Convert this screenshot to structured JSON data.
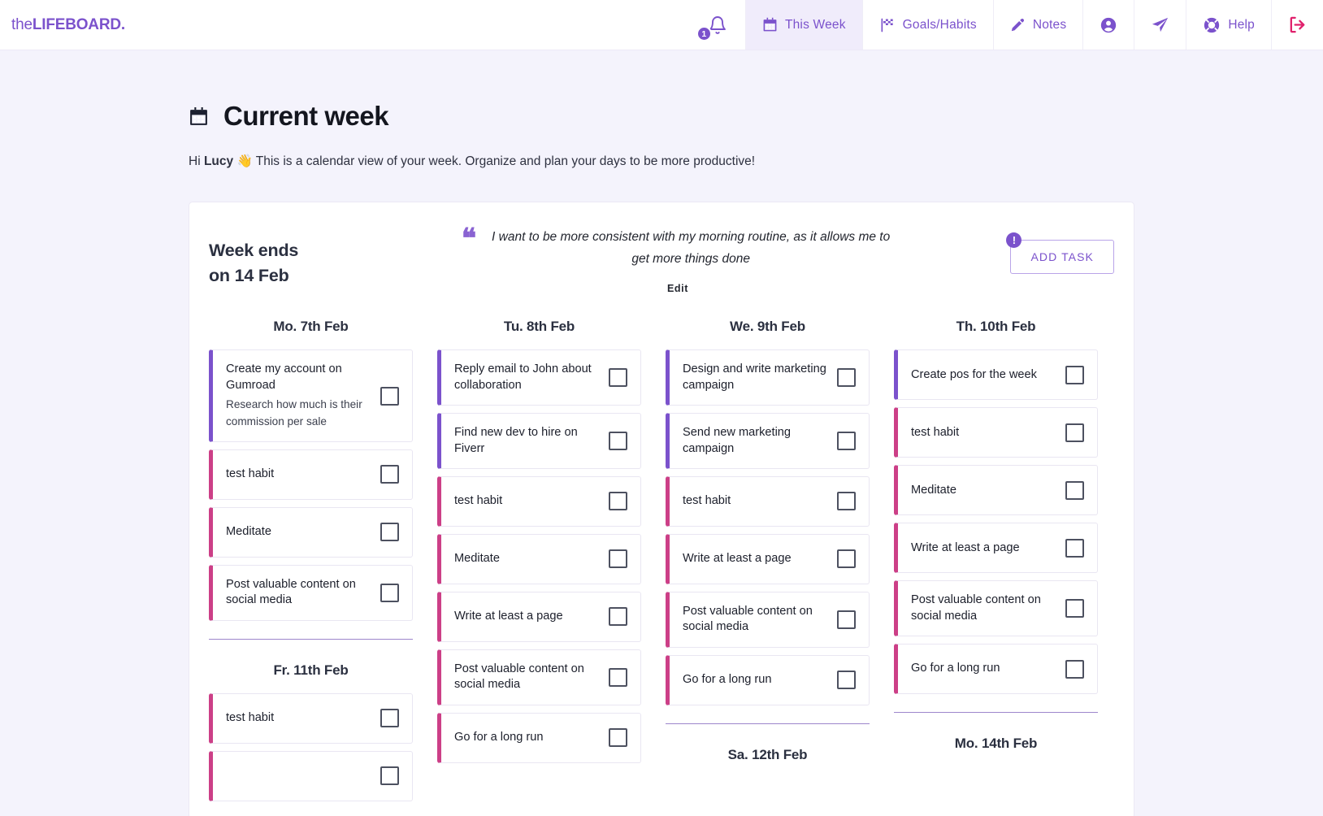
{
  "brand": {
    "thin": "the",
    "thick": "LIFEBOARD."
  },
  "nav": {
    "notifications_count": "1",
    "items": [
      {
        "label": "This Week",
        "icon": "calendar-icon",
        "active": true
      },
      {
        "label": "Goals/Habits",
        "icon": "flag-icon",
        "active": false
      },
      {
        "label": "Notes",
        "icon": "pen-icon",
        "active": false
      },
      {
        "label": "",
        "icon": "account-icon",
        "active": false
      },
      {
        "label": "",
        "icon": "send-icon",
        "active": false
      },
      {
        "label": "Help",
        "icon": "lifering-icon",
        "active": false
      },
      {
        "label": "",
        "icon": "logout-icon",
        "active": false
      }
    ]
  },
  "header": {
    "title": "Current week",
    "greeting_pre": "Hi ",
    "greeting_name": "Lucy",
    "greeting_post": " 👋 This is a calendar view of your week. Organize and plan your days to be more productive!"
  },
  "panel": {
    "week_ends_line1": "Week ends",
    "week_ends_line2": "on 14 Feb",
    "quote": "I want to be more consistent with my morning routine, as it allows me to get more things done",
    "quote_edit": "Edit",
    "add_task": "ADD TASK",
    "info_badge": "!"
  },
  "colors": {
    "accent": "#7b52cc",
    "habit": "#cc3f87",
    "logout": "#e0206c",
    "nav_active_bg": "#f0ecfb",
    "page_bg": "#f4f3fc"
  },
  "columns": [
    {
      "day": "Mo. 7th Feb",
      "tasks": [
        {
          "title": "Create my account on Gumroad",
          "desc": "Research how much is their commission per sale",
          "type": "task",
          "checked": false
        },
        {
          "title": "test habit",
          "desc": "",
          "type": "habit",
          "checked": false
        },
        {
          "title": "Meditate",
          "desc": "",
          "type": "habit",
          "checked": false
        },
        {
          "title": "Post valuable content on social media",
          "desc": "",
          "type": "habit",
          "checked": false
        }
      ],
      "second_day": "Fr. 11th Feb",
      "second_tasks": [
        {
          "title": "test habit",
          "desc": "",
          "type": "habit",
          "checked": false
        },
        {
          "title": "",
          "desc": "",
          "type": "habit",
          "checked": false
        }
      ]
    },
    {
      "day": "Tu. 8th Feb",
      "tasks": [
        {
          "title": "Reply email to John about collaboration",
          "desc": "",
          "type": "task",
          "checked": false
        },
        {
          "title": "Find new dev to hire on Fiverr",
          "desc": "",
          "type": "task",
          "checked": false
        },
        {
          "title": "test habit",
          "desc": "",
          "type": "habit",
          "checked": false
        },
        {
          "title": "Meditate",
          "desc": "",
          "type": "habit",
          "checked": false
        },
        {
          "title": "Write at least a page",
          "desc": "",
          "type": "habit",
          "checked": false
        },
        {
          "title": "Post valuable content on social media",
          "desc": "",
          "type": "habit",
          "checked": false
        },
        {
          "title": "Go for a long run",
          "desc": "",
          "type": "habit",
          "checked": false
        }
      ],
      "second_day": "",
      "second_tasks": []
    },
    {
      "day": "We. 9th Feb",
      "tasks": [
        {
          "title": "Design and write marketing campaign",
          "desc": "",
          "type": "task",
          "checked": false
        },
        {
          "title": "Send new marketing campaign",
          "desc": "",
          "type": "task",
          "checked": false
        },
        {
          "title": "test habit",
          "desc": "",
          "type": "habit",
          "checked": false
        },
        {
          "title": "Write at least a page",
          "desc": "",
          "type": "habit",
          "checked": false
        },
        {
          "title": "Post valuable content on social media",
          "desc": "",
          "type": "habit",
          "checked": false
        },
        {
          "title": "Go for a long run",
          "desc": "",
          "type": "habit",
          "checked": false
        }
      ],
      "second_day": "Sa. 12th Feb",
      "second_tasks": []
    },
    {
      "day": "Th. 10th Feb",
      "tasks": [
        {
          "title": "Create pos for the week",
          "desc": "",
          "type": "task",
          "checked": false
        },
        {
          "title": "test habit",
          "desc": "",
          "type": "habit",
          "checked": false
        },
        {
          "title": "Meditate",
          "desc": "",
          "type": "habit",
          "checked": false
        },
        {
          "title": "Write at least a page",
          "desc": "",
          "type": "habit",
          "checked": false
        },
        {
          "title": "Post valuable content on social media",
          "desc": "",
          "type": "habit",
          "checked": false
        },
        {
          "title": "Go for a long run",
          "desc": "",
          "type": "habit",
          "checked": false
        }
      ],
      "second_day": "Mo. 14th Feb",
      "second_tasks": []
    }
  ]
}
